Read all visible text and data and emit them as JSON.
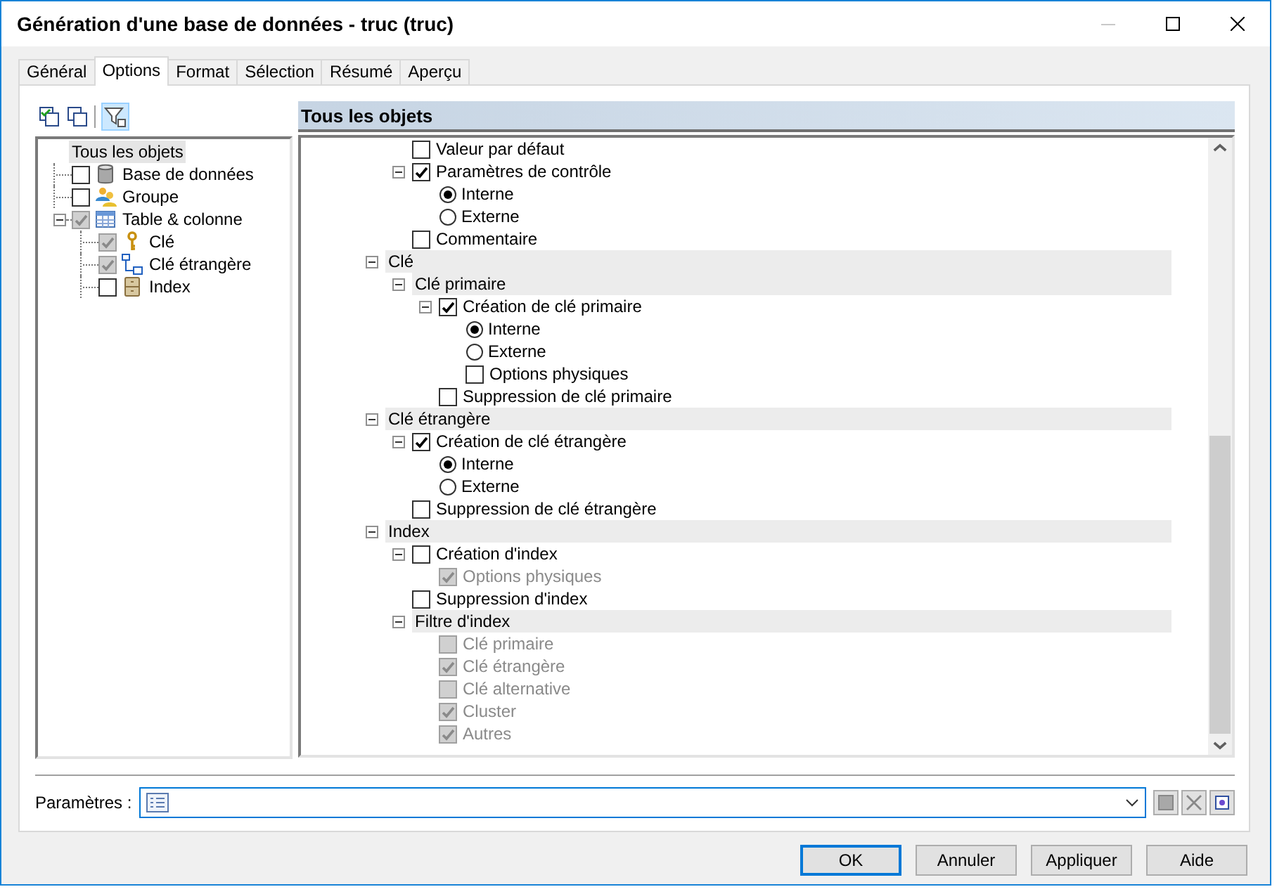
{
  "window": {
    "title": "Génération d'une base de données - truc (truc)"
  },
  "tabs": [
    {
      "label": "Général",
      "selected": false
    },
    {
      "label": "Options",
      "selected": true
    },
    {
      "label": "Format",
      "selected": false
    },
    {
      "label": "Sélection",
      "selected": false
    },
    {
      "label": "Résumé",
      "selected": false
    },
    {
      "label": "Aperçu",
      "selected": false
    }
  ],
  "object_tree": {
    "label": "Tous les objets",
    "selected": true,
    "children": [
      {
        "kind": "database",
        "label": "Base de données",
        "checked": false,
        "disabled": false
      },
      {
        "kind": "group",
        "label": "Groupe",
        "checked": false,
        "disabled": false
      },
      {
        "kind": "table",
        "label": "Table & colonne",
        "checked": true,
        "disabled": true,
        "expanded": true,
        "children": [
          {
            "kind": "key",
            "label": "Clé",
            "checked": true,
            "disabled": true
          },
          {
            "kind": "link",
            "label": "Clé étrangère",
            "checked": true,
            "disabled": true
          },
          {
            "kind": "index",
            "label": "Index",
            "checked": false,
            "disabled": false
          }
        ]
      }
    ]
  },
  "options_panel": {
    "title": "Tous les objets",
    "continued": [
      {
        "kind": "checkbox",
        "label": "Valeur par défaut",
        "checked": false,
        "disabled": false
      },
      {
        "kind": "checkbox",
        "label": "Paramètres de contrôle",
        "checked": true,
        "disabled": false,
        "expanded": true,
        "children": [
          {
            "kind": "radio",
            "label": "Interne",
            "selected": true
          },
          {
            "kind": "radio",
            "label": "Externe",
            "selected": false
          }
        ]
      },
      {
        "kind": "checkbox",
        "label": "Commentaire",
        "checked": false,
        "disabled": false
      }
    ],
    "sections": [
      {
        "kind": "header",
        "label": "Clé",
        "expanded": true,
        "children": [
          {
            "kind": "header",
            "label": "Clé primaire",
            "expanded": true,
            "children": [
              {
                "kind": "checkbox",
                "label": "Création de clé primaire",
                "checked": true,
                "disabled": false,
                "expanded": true,
                "children": [
                  {
                    "kind": "radio",
                    "label": "Interne",
                    "selected": true
                  },
                  {
                    "kind": "radio",
                    "label": "Externe",
                    "selected": false
                  },
                  {
                    "kind": "checkbox",
                    "label": "Options physiques",
                    "checked": false,
                    "disabled": false
                  }
                ]
              },
              {
                "kind": "checkbox",
                "label": "Suppression de clé primaire",
                "checked": false,
                "disabled": false
              }
            ]
          }
        ]
      },
      {
        "kind": "header",
        "label": "Clé étrangère",
        "expanded": true,
        "children": [
          {
            "kind": "checkbox",
            "label": "Création de clé étrangère",
            "checked": true,
            "disabled": false,
            "expanded": true,
            "children": [
              {
                "kind": "radio",
                "label": "Interne",
                "selected": true
              },
              {
                "kind": "radio",
                "label": "Externe",
                "selected": false
              }
            ]
          },
          {
            "kind": "checkbox",
            "label": "Suppression de clé étrangère",
            "checked": false,
            "disabled": false
          }
        ]
      },
      {
        "kind": "header",
        "label": "Index",
        "expanded": true,
        "children": [
          {
            "kind": "checkbox",
            "label": "Création d'index",
            "checked": false,
            "disabled": false,
            "expanded": true,
            "children": [
              {
                "kind": "checkbox",
                "label": "Options physiques",
                "checked": true,
                "disabled": true
              }
            ]
          },
          {
            "kind": "checkbox",
            "label": "Suppression d'index",
            "checked": false,
            "disabled": false
          },
          {
            "kind": "header",
            "label": "Filtre d'index",
            "expanded": true,
            "children": [
              {
                "kind": "checkbox",
                "label": "Clé primaire",
                "checked": false,
                "disabled": true
              },
              {
                "kind": "checkbox",
                "label": "Clé étrangère",
                "checked": true,
                "disabled": true
              },
              {
                "kind": "checkbox",
                "label": "Clé alternative",
                "checked": false,
                "disabled": true
              },
              {
                "kind": "checkbox",
                "label": "Cluster",
                "checked": true,
                "disabled": true
              },
              {
                "kind": "checkbox",
                "label": "Autres",
                "checked": true,
                "disabled": true
              }
            ]
          }
        ]
      }
    ]
  },
  "parameters": {
    "label": "Paramètres :"
  },
  "buttons": [
    {
      "label": "OK",
      "default": true
    },
    {
      "label": "Annuler",
      "default": false
    },
    {
      "label": "Appliquer",
      "default": false
    },
    {
      "label": "Aide",
      "default": false
    }
  ]
}
